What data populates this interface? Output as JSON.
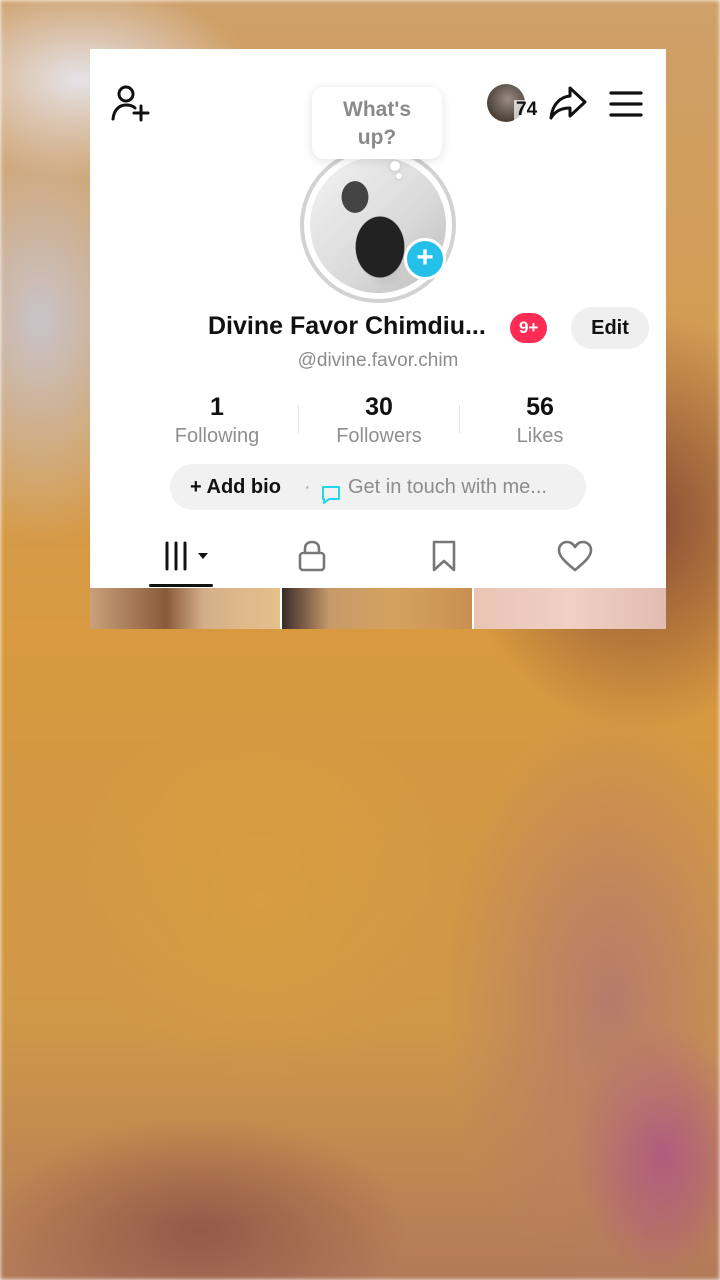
{
  "header": {
    "add_friend_icon": "person-plus-icon",
    "share_icon": "share-arrow-icon",
    "menu_icon": "hamburger-menu-icon",
    "visitor_count": "74"
  },
  "status_bubble": {
    "text_line1": "What's",
    "text_line2": "up?"
  },
  "profile": {
    "name": "Divine Favor Chimdiu...",
    "notification_badge": "9+",
    "edit_label": "Edit",
    "username": "@divine.favor.chim"
  },
  "stats": [
    {
      "value": "1",
      "label": "Following"
    },
    {
      "value": "30",
      "label": "Followers"
    },
    {
      "value": "56",
      "label": "Likes"
    }
  ],
  "bio": {
    "add_label": "+ Add bio",
    "separator": "·",
    "touch_label": "Get in touch with me..."
  },
  "tabs": [
    {
      "name": "videos",
      "icon": "grid-bars-icon"
    },
    {
      "name": "private",
      "icon": "lock-icon"
    },
    {
      "name": "saved",
      "icon": "bookmark-icon"
    },
    {
      "name": "liked",
      "icon": "heart-icon"
    }
  ],
  "colors": {
    "accent_badge": "#fe2c55",
    "avatar_plus": "#25c0ea",
    "message_icon": "#20d5ec"
  }
}
